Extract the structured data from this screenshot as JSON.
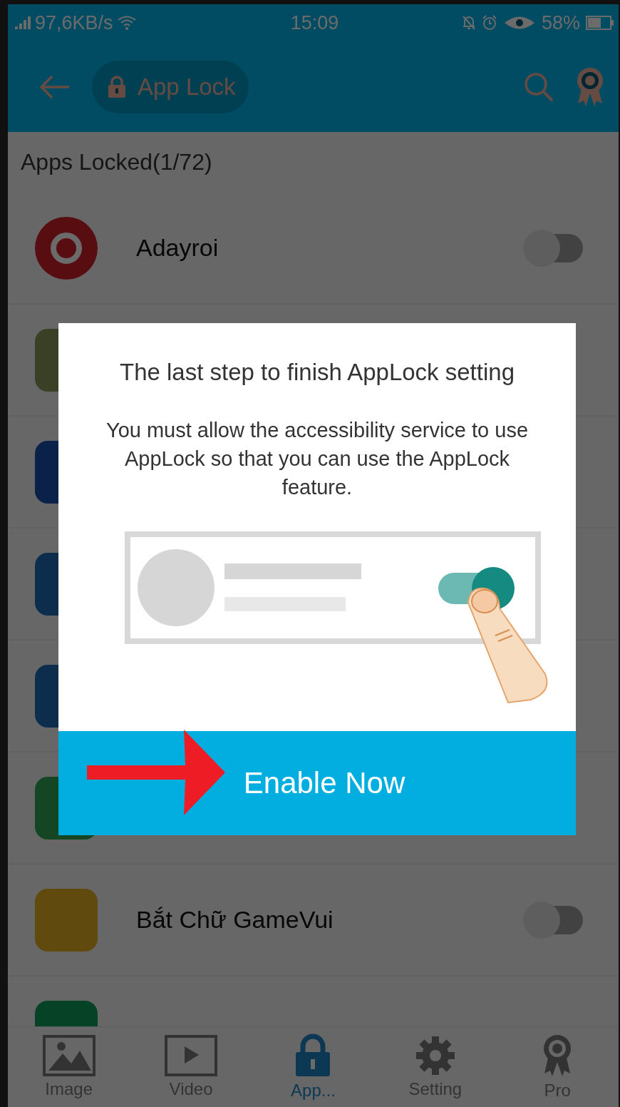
{
  "status_bar": {
    "speed": "97,6KB/s",
    "time": "15:09",
    "battery": "58%"
  },
  "header": {
    "title": "App Lock"
  },
  "section_title": "Apps Locked(1/72)",
  "apps": [
    {
      "kind": "app",
      "name": "Adayroi",
      "locked": false
    },
    {
      "kind": "covered"
    },
    {
      "kind": "covered"
    },
    {
      "kind": "covered"
    },
    {
      "kind": "covered"
    },
    {
      "kind": "covered"
    },
    {
      "kind": "app",
      "name": "Bắt Chữ GameVui",
      "locked": false
    },
    {
      "kind": "covered"
    }
  ],
  "dialog": {
    "title": "The last step to finish AppLock setting",
    "message": "You must allow the accessibility service to use AppLock so that you can use the AppLock feature.",
    "button": "Enable Now"
  },
  "nav": [
    {
      "label": "Image",
      "selected": false
    },
    {
      "label": "Video",
      "selected": false
    },
    {
      "label": "App...",
      "selected": true
    },
    {
      "label": "Setting",
      "selected": false
    },
    {
      "label": "Pro",
      "selected": false
    }
  ]
}
